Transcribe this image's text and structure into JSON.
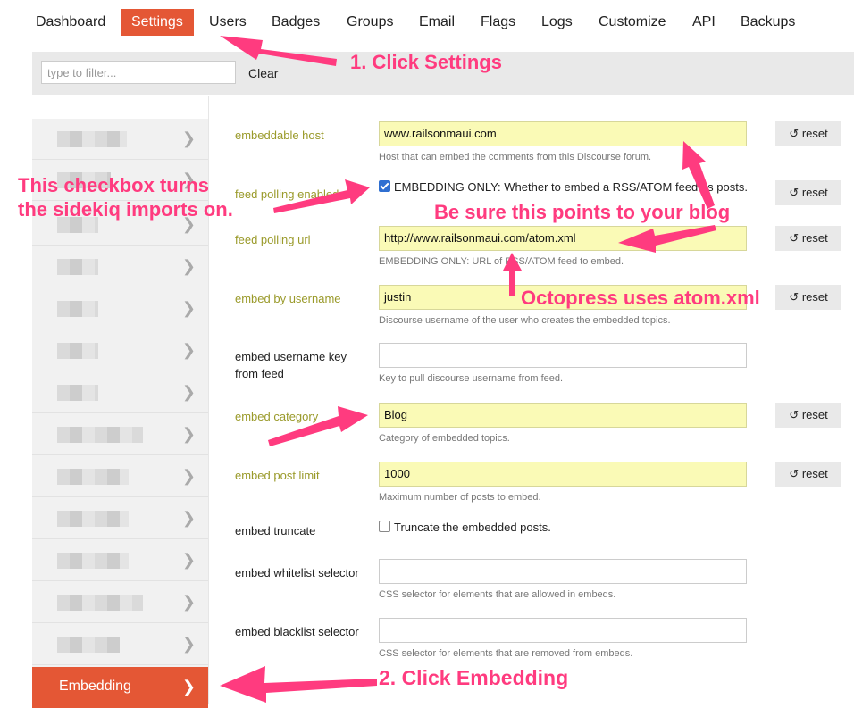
{
  "nav": {
    "items": [
      "Dashboard",
      "Settings",
      "Users",
      "Badges",
      "Groups",
      "Email",
      "Flags",
      "Logs",
      "Customize",
      "API",
      "Backups"
    ],
    "active": "Settings"
  },
  "filter": {
    "placeholder": "type to filter...",
    "clear_label": "Clear"
  },
  "sidebar": {
    "active_label": "Embedding"
  },
  "settings": [
    {
      "label": "embeddable host",
      "value": "www.railsonmaui.com",
      "description": "Host that can embed the comments from this Discourse forum.",
      "reset": "reset"
    },
    {
      "label": "feed polling enabled",
      "checkbox_text": "EMBEDDING ONLY: Whether to embed a RSS/ATOM feed as posts.",
      "checked": true,
      "reset": "reset"
    },
    {
      "label": "feed polling url",
      "value": "http://www.railsonmaui.com/atom.xml",
      "description": "EMBEDDING ONLY: URL of RSS/ATOM feed to embed.",
      "reset": "reset"
    },
    {
      "label": "embed by username",
      "value": "justin",
      "description": "Discourse username of the user who creates the embedded topics.",
      "reset": "reset"
    },
    {
      "label": "embed username key from feed",
      "value": "",
      "description": "Key to pull discourse username from feed."
    },
    {
      "label": "embed category",
      "value": "Blog",
      "description": "Category of embedded topics.",
      "reset": "reset"
    },
    {
      "label": "embed post limit",
      "value": "1000",
      "description": "Maximum number of posts to embed.",
      "reset": "reset"
    },
    {
      "label": "embed truncate",
      "checkbox_text": "Truncate the embedded posts.",
      "checked": false
    },
    {
      "label": "embed whitelist selector",
      "value": "",
      "description": "CSS selector for elements that are allowed in embeds."
    },
    {
      "label": "embed blacklist selector",
      "value": "",
      "description": "CSS selector for elements that are removed from embeds."
    }
  ],
  "annotations": {
    "click_settings": "1. Click Settings",
    "checkbox_line1": "This checkbox turns",
    "checkbox_line2": "the sidekiq imports on.",
    "blog_note": "Be sure this points to your blog",
    "octopress_note": "Octopress uses atom.xml",
    "click_embedding": "2. Click Embedding"
  },
  "colors": {
    "accent": "#e45735",
    "changed_bg": "#fafab6",
    "changed_label": "#9a9a2a",
    "annotation": "#ff3b7f"
  }
}
